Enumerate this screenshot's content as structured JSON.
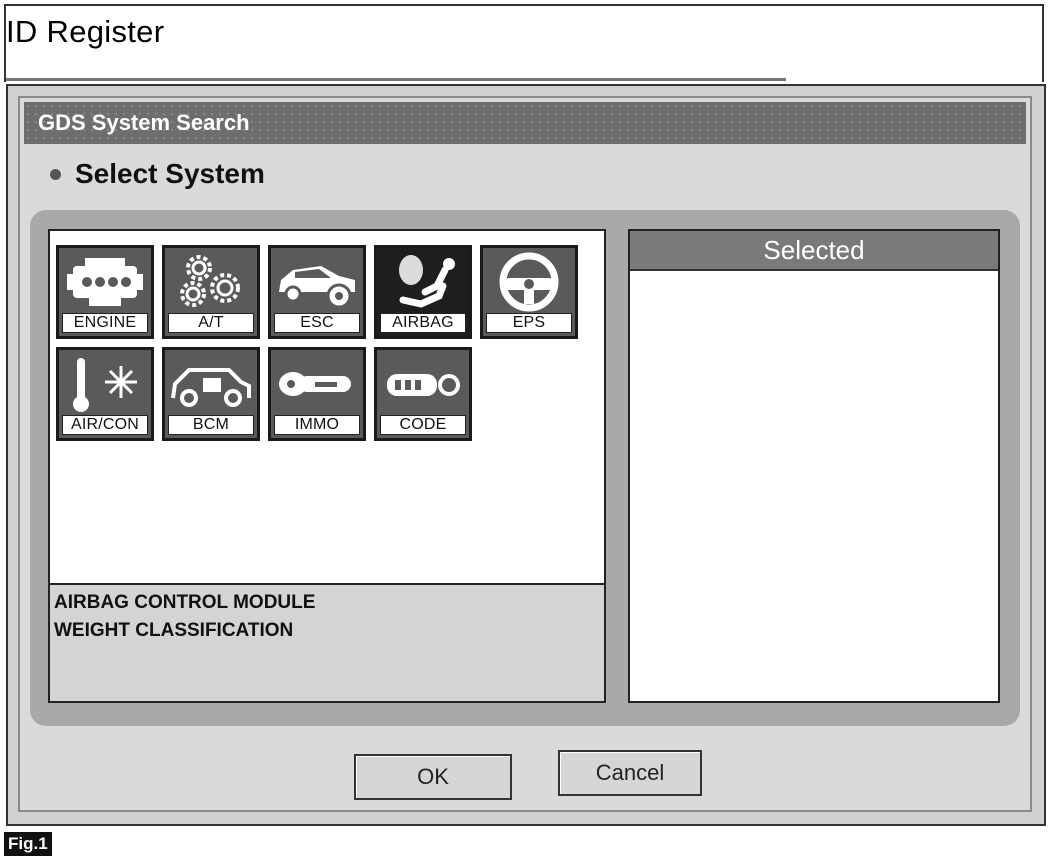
{
  "page": {
    "title": "ID Register"
  },
  "dialog": {
    "title": "GDS System Search",
    "section_title": "Select System",
    "systems": [
      {
        "label": "ENGINE",
        "icon": "engine-icon",
        "selected": false
      },
      {
        "label": "A/T",
        "icon": "gears-icon",
        "selected": false
      },
      {
        "label": "ESC",
        "icon": "car-icon",
        "selected": false
      },
      {
        "label": "AIRBAG",
        "icon": "airbag-icon",
        "selected": true
      },
      {
        "label": "EPS",
        "icon": "steering-wheel-icon",
        "selected": false
      },
      {
        "label": "AIR/CON",
        "icon": "air-con-icon",
        "selected": false
      },
      {
        "label": "BCM",
        "icon": "car-body-icon",
        "selected": false
      },
      {
        "label": "IMMO",
        "icon": "key-icon",
        "selected": false
      },
      {
        "label": "CODE",
        "icon": "remote-key-icon",
        "selected": false
      }
    ],
    "description_lines": [
      "AIRBAG CONTROL MODULE",
      "WEIGHT CLASSIFICATION"
    ],
    "selected_header": "Selected",
    "ok_label": "OK",
    "cancel_label": "Cancel"
  },
  "figure_label": "Fig.1",
  "colors": {
    "titlebar": "#6e6e6e",
    "tile_bg": "#5a5a5a",
    "tile_selected_bg": "#1e1e1e",
    "tray": "#a9a9a9"
  }
}
